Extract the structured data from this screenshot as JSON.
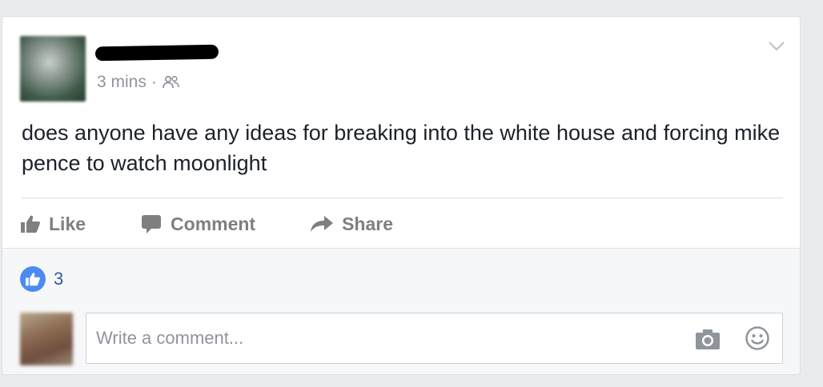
{
  "post": {
    "timestamp": "3 mins",
    "separator": "·",
    "audience_icon": "friends-icon",
    "text": "does anyone have any ideas for breaking into the white house and forcing mike pence to watch moonlight"
  },
  "actions": {
    "like_label": "Like",
    "comment_label": "Comment",
    "share_label": "Share"
  },
  "reactions": {
    "count": "3",
    "icon": "like-reaction-icon",
    "color": "#4d8af0"
  },
  "comment_box": {
    "placeholder": "Write a comment...",
    "camera_icon": "camera-icon",
    "emoji_icon": "smiley-icon"
  },
  "colors": {
    "background": "#e9ebee",
    "link": "#365899",
    "muted_text": "#90949c",
    "action_text": "#7f7f7f"
  }
}
